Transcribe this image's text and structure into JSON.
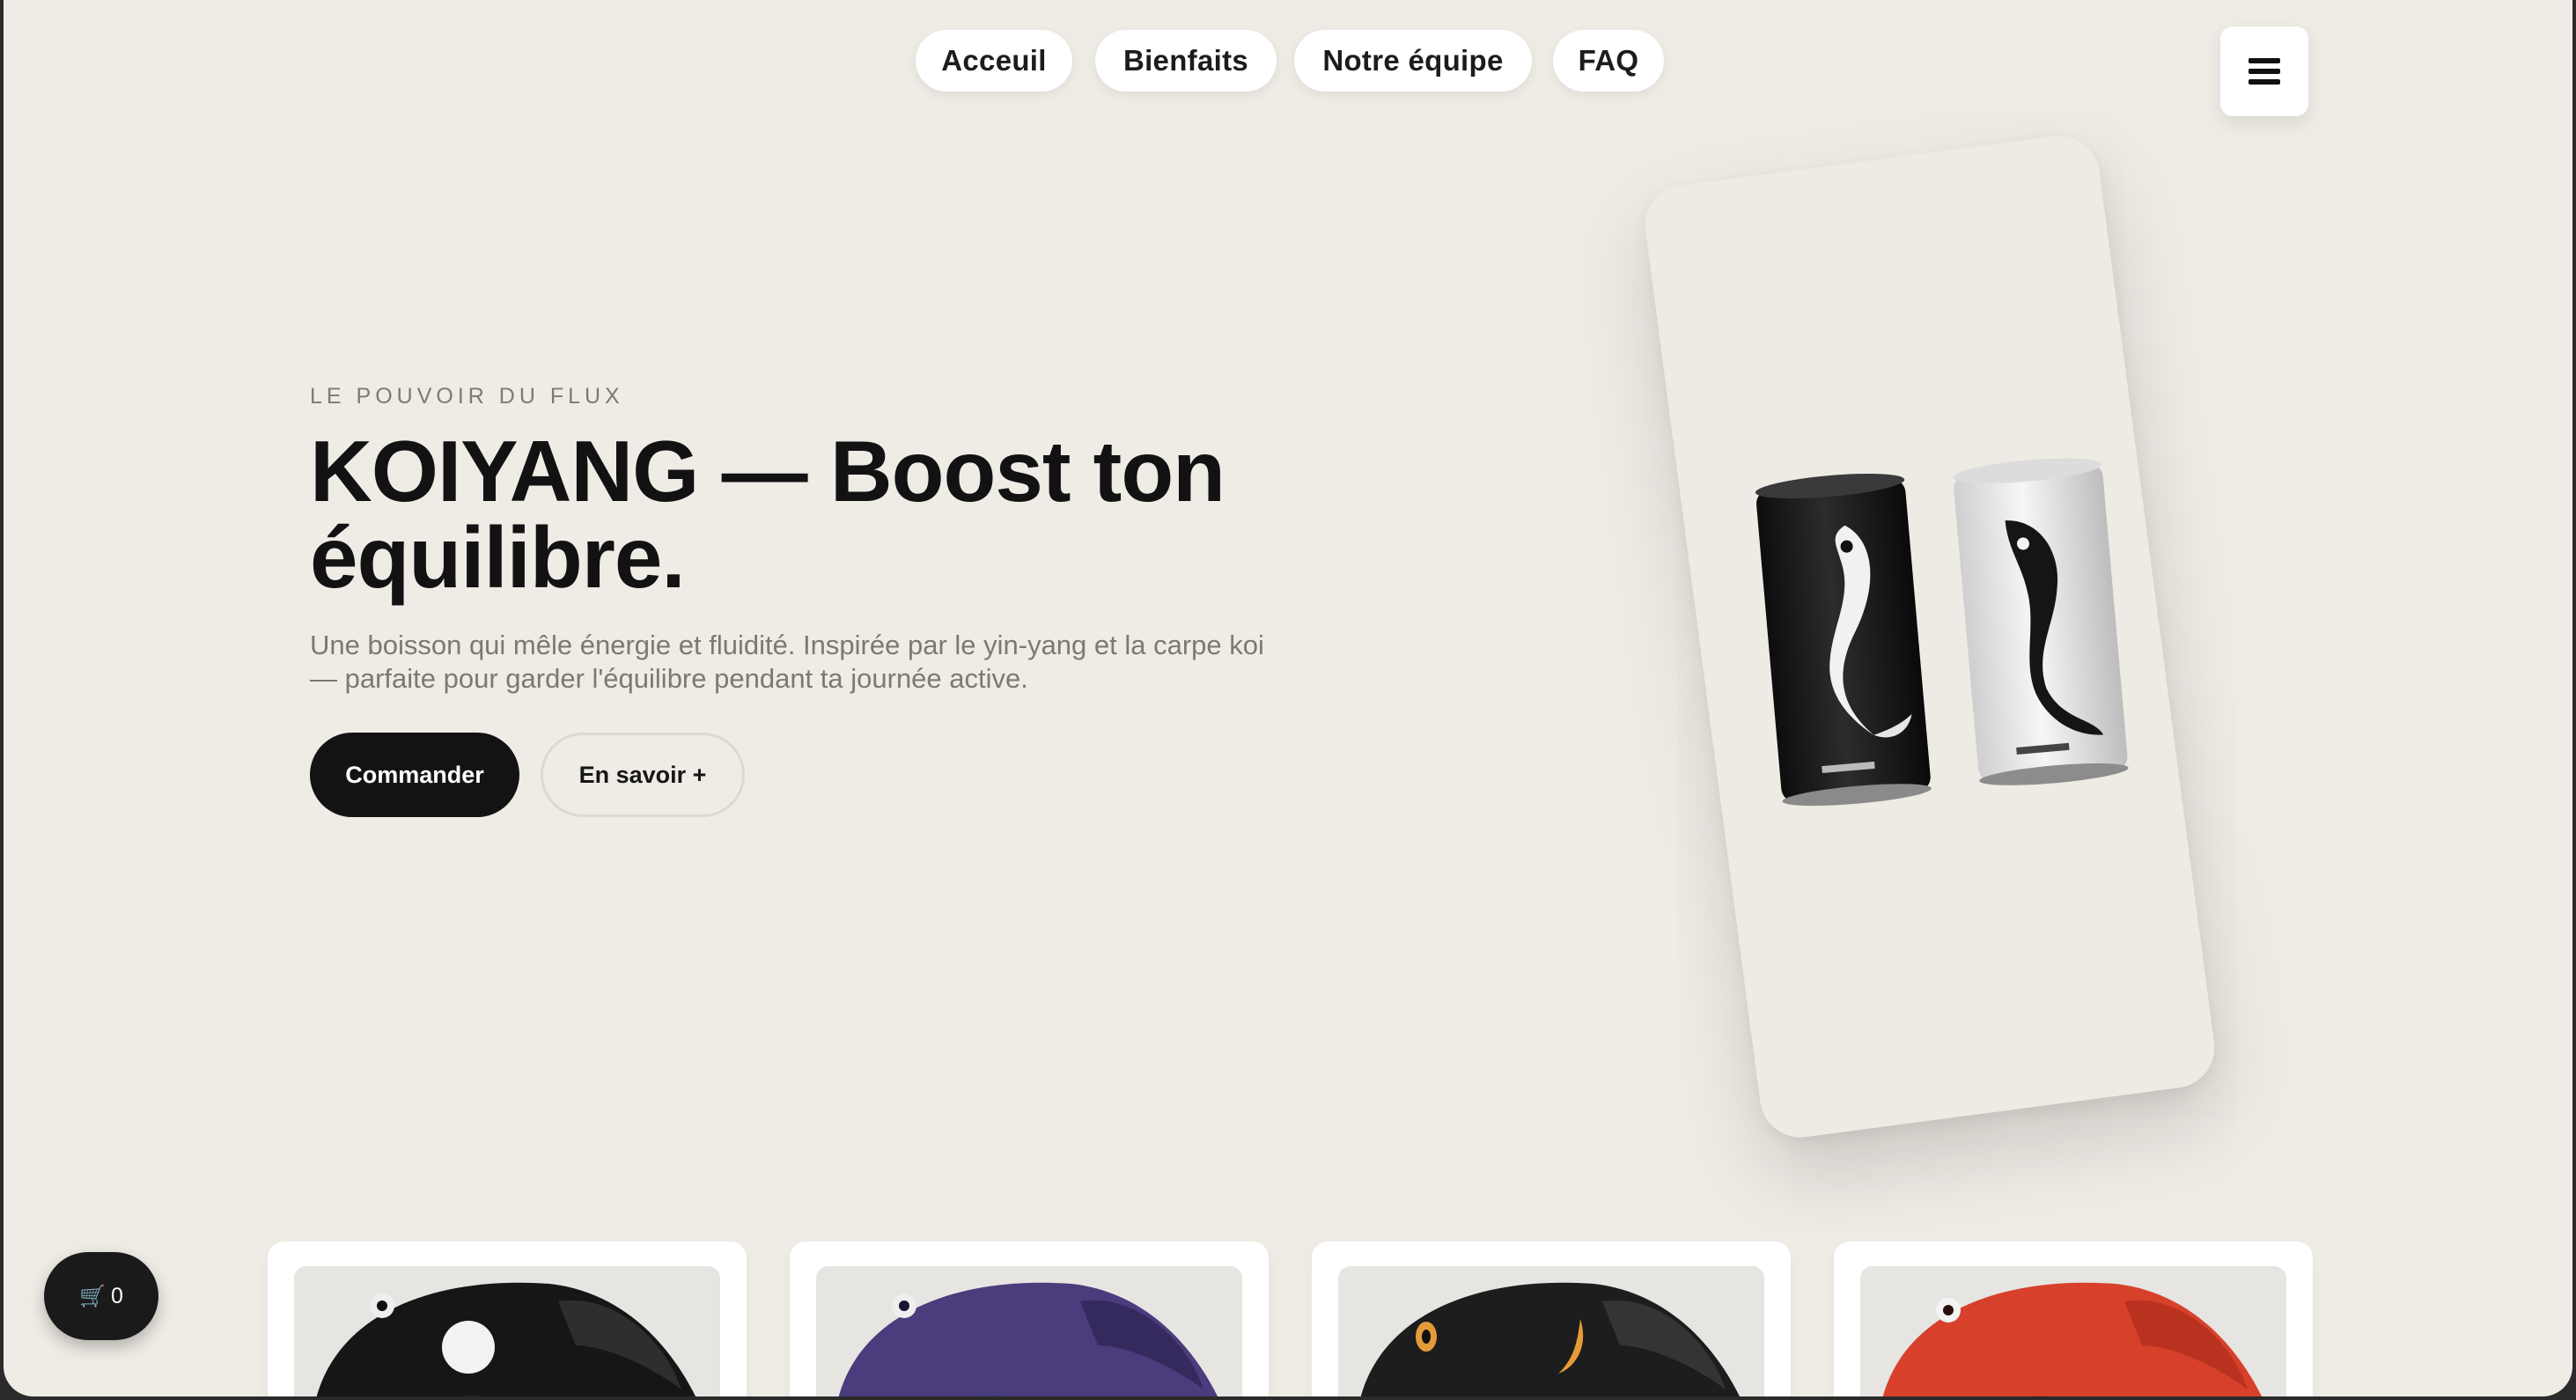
{
  "nav": {
    "items": [
      {
        "label": "Acceuil"
      },
      {
        "label": "Bienfaits"
      },
      {
        "label": "Notre équipe"
      },
      {
        "label": "FAQ"
      }
    ],
    "menu_icon": "hamburger-icon"
  },
  "hero": {
    "eyebrow": "LE POUVOIR DU FLUX",
    "title_line1": "KOIYANG — Boost ton",
    "title_line2": "équilibre.",
    "description": "Une boisson qui mêle énergie et fluidité. Inspirée par le yin-yang et la carpe koi — parfaite pour garder l'équilibre pendant ta journée active.",
    "primary_button": "Commander",
    "secondary_button": "En savoir +"
  },
  "product_visual": {
    "cans": [
      "black-can",
      "white-can"
    ]
  },
  "products": {
    "tiles": [
      {
        "accent": "#1b1b1b"
      },
      {
        "accent": "#4b3c7e"
      },
      {
        "accent": "#1f1f1f"
      },
      {
        "accent": "#d8412c"
      }
    ]
  },
  "cart": {
    "icon": "cart-icon",
    "count": "0"
  },
  "colors": {
    "background": "#efebe5",
    "primary": "#131313",
    "surface": "#ffffff"
  }
}
